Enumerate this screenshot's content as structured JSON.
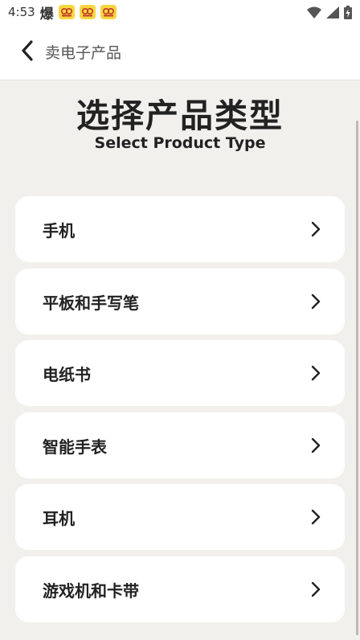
{
  "status_bar": {
    "time": "4:53",
    "glyph": "爆",
    "notification_icons": [
      "notif-app-icon",
      "notif-app-icon",
      "notif-app-icon"
    ],
    "right_icons": [
      "wifi-icon",
      "signal-icon",
      "battery-icon"
    ]
  },
  "app_bar": {
    "title": "卖电子产品",
    "back_icon": "chevron-left-icon"
  },
  "header": {
    "title": "选择产品类型",
    "subtitle": "Select Product Type"
  },
  "categories": [
    {
      "label": "手机"
    },
    {
      "label": "平板和手写笔"
    },
    {
      "label": "电纸书"
    },
    {
      "label": "智能手表"
    },
    {
      "label": "耳机"
    },
    {
      "label": "游戏机和卡带"
    }
  ],
  "colors": {
    "background": "#f1f0ed",
    "card": "#ffffff",
    "text": "#222222",
    "notif": "#f7d640"
  }
}
